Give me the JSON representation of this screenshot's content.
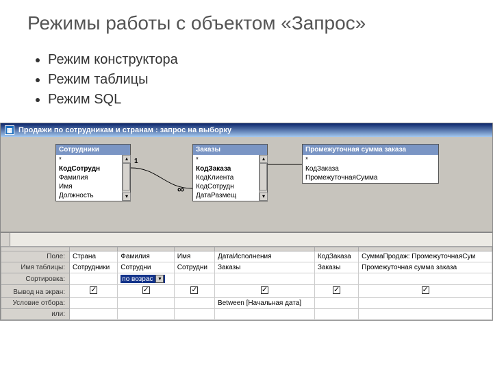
{
  "title": "Режимы работы с объектом «Запрос»",
  "bullets": [
    "Режим конструктора",
    "Режим таблицы",
    "Режим SQL"
  ],
  "window": {
    "title": "Продажи по сотрудникам и странам : запрос на выборку"
  },
  "tables": {
    "t1": {
      "name": "Сотрудники",
      "fields": [
        "*",
        "КодСотрудн",
        "Фамилия",
        "Имя",
        "Должность"
      ],
      "bold_idx": 1
    },
    "t2": {
      "name": "Заказы",
      "fields": [
        "*",
        "КодЗаказа",
        "КодКлиента",
        "КодСотрудн",
        "ДатаРазмещ"
      ],
      "bold_idx": 1
    },
    "t3": {
      "name": "Промежуточная сумма заказа",
      "fields": [
        "*",
        "КодЗаказа",
        "ПромежуточнаяСумма"
      ]
    }
  },
  "relations": {
    "one": "1",
    "many": "∞"
  },
  "grid": {
    "labels": {
      "field": "Поле:",
      "table": "Имя таблицы:",
      "sort": "Сортировка:",
      "show": "Вывод на экран:",
      "criteria": "Условие отбора:",
      "or": "или:"
    },
    "sort_value": "по возрас",
    "cols": [
      {
        "field": "Страна",
        "table": "Сотрудники",
        "sort": false,
        "show": true,
        "criteria": ""
      },
      {
        "field": "Фамилия",
        "table": "Сотрудни",
        "sort": true,
        "show": true,
        "criteria": ""
      },
      {
        "field": "Имя",
        "table": "Сотрудни",
        "sort": false,
        "show": true,
        "criteria": ""
      },
      {
        "field": "ДатаИсполнения",
        "table": "Заказы",
        "sort": false,
        "show": true,
        "criteria": "Between [Начальная дата]"
      },
      {
        "field": "КодЗаказа",
        "table": "Заказы",
        "sort": false,
        "show": true,
        "criteria": ""
      },
      {
        "field": "СуммаПродаж: ПромежуточнаяСум",
        "table": "Промежуточная сумма заказа",
        "sort": false,
        "show": true,
        "criteria": ""
      }
    ]
  }
}
